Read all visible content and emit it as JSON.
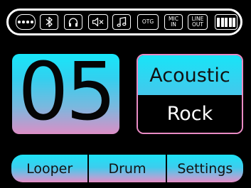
{
  "status_bar": {
    "icons": [
      {
        "name": "more-icon"
      },
      {
        "name": "bluetooth-icon"
      },
      {
        "name": "headphones-icon"
      },
      {
        "name": "speaker-muted-icon"
      },
      {
        "name": "music-note-icon"
      },
      {
        "name": "otg-icon",
        "label": "OTG"
      },
      {
        "name": "mic-in-icon",
        "line1": "MIC",
        "line2": "IN"
      },
      {
        "name": "line-out-icon",
        "line1": "LINE",
        "line2": "OUT"
      },
      {
        "name": "battery-icon",
        "level_bars": 5,
        "max_bars": 5
      }
    ]
  },
  "preset": {
    "number": "05",
    "category": "Acoustic",
    "style": "Rock"
  },
  "nav": {
    "looper": "Looper",
    "drum": "Drum",
    "settings": "Settings"
  },
  "colors": {
    "background": "#000000",
    "cyan": "#17e7f9",
    "pink": "#e98bc4",
    "outline": "#ffffff"
  }
}
